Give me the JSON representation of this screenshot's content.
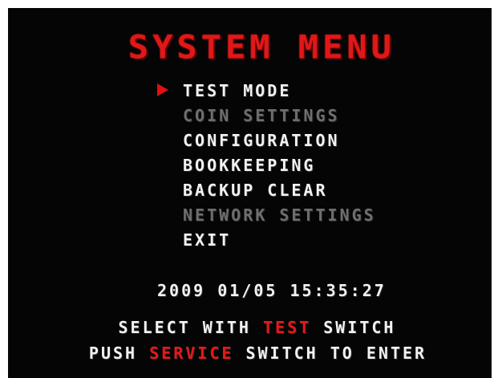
{
  "colors": {
    "background": "#050505",
    "title": "#e01818",
    "item_enabled": "#f2f2f2",
    "item_disabled": "#6e6e6e",
    "highlight": "#e81818",
    "cursor": "#e01010"
  },
  "title": "SYSTEM MENU",
  "cursor_icon": "red-right-triangle",
  "menu": {
    "selected_index": 0,
    "items": [
      {
        "label": "TEST MODE",
        "enabled": true
      },
      {
        "label": "COIN SETTINGS",
        "enabled": false
      },
      {
        "label": "CONFIGURATION",
        "enabled": true
      },
      {
        "label": "BOOKKEEPING",
        "enabled": true
      },
      {
        "label": "BACKUP CLEAR",
        "enabled": true
      },
      {
        "label": "NETWORK SETTINGS",
        "enabled": false
      },
      {
        "label": "EXIT",
        "enabled": true
      }
    ]
  },
  "clock": "2009 01/05 15:35:27",
  "instructions": {
    "line1": {
      "pre": "SELECT WITH ",
      "key": "TEST",
      "post": " SWITCH"
    },
    "line2": {
      "pre": "PUSH ",
      "key": "SERVICE",
      "post": " SWITCH TO ENTER"
    }
  }
}
